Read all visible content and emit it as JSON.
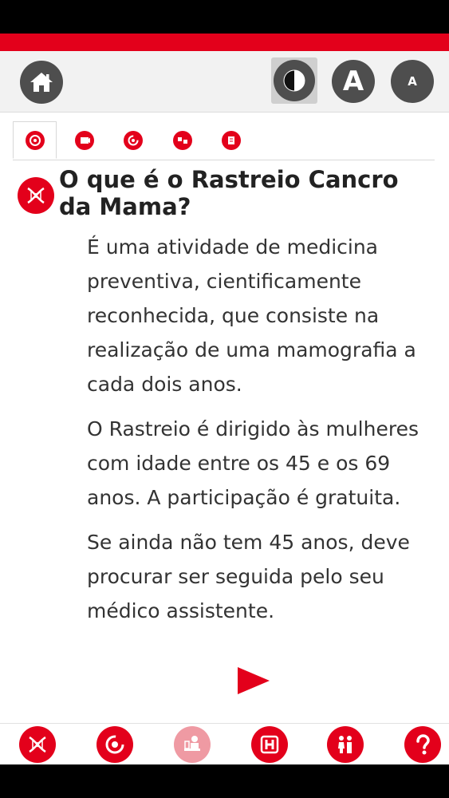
{
  "colors": {
    "brand_red": "#e3001b",
    "toolbar_gray": "#4e4e4e",
    "text": "#333333"
  },
  "toolbar": {
    "home_icon": "home-icon",
    "contrast_icon": "contrast-icon",
    "font_large_label": "A",
    "font_small_label": "A"
  },
  "tabs": [
    {
      "icon": "target-icon",
      "active": true
    },
    {
      "icon": "video-icon",
      "active": false
    },
    {
      "icon": "cycle-icon",
      "active": false
    },
    {
      "icon": "group-icon",
      "active": false
    },
    {
      "icon": "document-icon",
      "active": false
    }
  ],
  "article": {
    "section_icon": "dna-icon",
    "title": "O que é o Rastreio Cancro da Mama?",
    "paragraphs": [
      "É uma atividade de medicina preventiva, cientificamente reconhecida, que consiste na realização de uma mamografia a cada dois anos.",
      "O Rastreio é dirigido às mulheres com idade entre os 45 e os 69 anos. A participação é gratuita.",
      "Se ainda não tem 45 anos, deve procurar ser seguida pelo seu médico assistente."
    ],
    "next_icon": "play-arrow-icon"
  },
  "bottom_nav": [
    {
      "icon": "dna-icon"
    },
    {
      "icon": "cycle-icon"
    },
    {
      "icon": "patient-icon",
      "active": true
    },
    {
      "icon": "hospital-icon"
    },
    {
      "icon": "family-icon"
    },
    {
      "icon": "help-icon"
    }
  ]
}
